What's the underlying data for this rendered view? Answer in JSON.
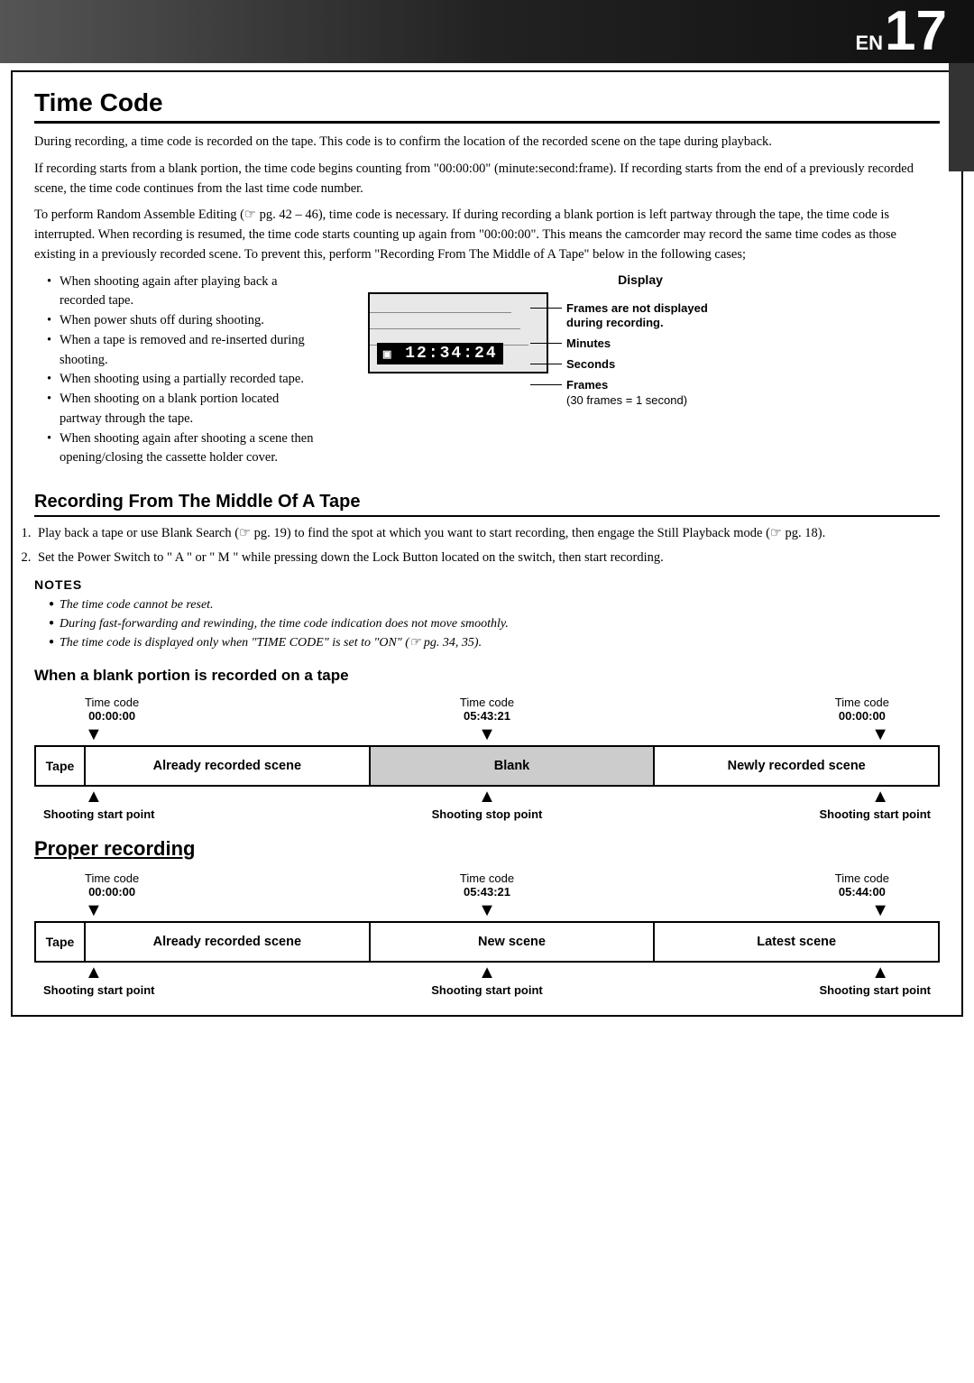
{
  "header": {
    "en_label": "EN",
    "page_number": "17"
  },
  "page_title": "Time Code",
  "intro_paragraphs": [
    "During recording, a time code is recorded on the tape. This code is to confirm the location of the recorded scene on the tape during playback.",
    "If recording starts from a blank portion, the time code begins counting from \"00:00:00\" (minute:second:frame). If recording starts from the end of a previously recorded scene, the time code continues from the last time code number.",
    "To perform Random Assemble Editing (☞ pg. 42 – 46), time code is necessary. If during recording a blank portion is left partway through the tape, the time code is interrupted. When recording is resumed, the time code starts counting up again from \"00:00:00\". This means the camcorder may record the same time codes as those existing in a previously recorded scene. To prevent this, perform \"Recording From The Middle of A Tape\" below in the following cases;"
  ],
  "bullet_points": [
    "When shooting again after playing back a recorded tape.",
    "When power shuts off during shooting.",
    "When a tape is removed and re-inserted during shooting.",
    "When shooting using a partially recorded tape.",
    "When shooting on a blank portion located partway through the tape.",
    "When shooting again after shooting a scene then opening/closing the cassette holder cover."
  ],
  "display_diagram": {
    "label": "Display",
    "timecode": "12:34:24",
    "tc_icon": "🔲",
    "annotations": [
      "Frames are not displayed during recording.",
      "Minutes",
      "Seconds",
      "Frames",
      "(30 frames = 1 second)"
    ]
  },
  "recording_section": {
    "title": "Recording From The Middle Of A Tape",
    "steps": [
      "Play back a tape or use Blank Search (☞ pg. 19) to find the spot at which you want to start recording, then engage the Still Playback mode (☞ pg. 18).",
      "Set the Power Switch to \" A \" or \" M \" while pressing down the Lock Button located on the switch, then start recording."
    ]
  },
  "notes": {
    "title": "NOTES",
    "items": [
      "The time code cannot be reset.",
      "During fast-forwarding and rewinding, the time code indication does not move smoothly.",
      "The time code is displayed only when \"TIME CODE\" is set to \"ON\" (☞ pg. 34, 35)."
    ]
  },
  "blank_diagram": {
    "title": "When a blank portion is recorded on a tape",
    "timecodes": [
      {
        "label": "Time code",
        "value": "00:00:00",
        "position": "left"
      },
      {
        "label": "Time code",
        "value": "05:43:21",
        "position": "center"
      },
      {
        "label": "Time code",
        "value": "00:00:00",
        "position": "right"
      }
    ],
    "tape_label": "Tape",
    "segments": [
      {
        "text": "Already recorded scene",
        "style": "normal"
      },
      {
        "text": "Blank",
        "style": "gray"
      },
      {
        "text": "Newly recorded scene",
        "style": "normal"
      }
    ],
    "shoot_labels": [
      "Shooting start point",
      "Shooting stop point",
      "Shooting start point"
    ]
  },
  "proper_diagram": {
    "title": "Proper recording",
    "timecodes": [
      {
        "label": "Time code",
        "value": "00:00:00",
        "position": "left"
      },
      {
        "label": "Time code",
        "value": "05:43:21",
        "position": "center"
      },
      {
        "label": "Time code",
        "value": "05:44:00",
        "position": "right"
      }
    ],
    "tape_label": "Tape",
    "segments": [
      {
        "text": "Already recorded scene",
        "style": "normal"
      },
      {
        "text": "New scene",
        "style": "normal"
      },
      {
        "text": "Latest scene",
        "style": "normal"
      }
    ],
    "shoot_labels": [
      "Shooting start point",
      "Shooting start point",
      "Shooting start point"
    ]
  }
}
